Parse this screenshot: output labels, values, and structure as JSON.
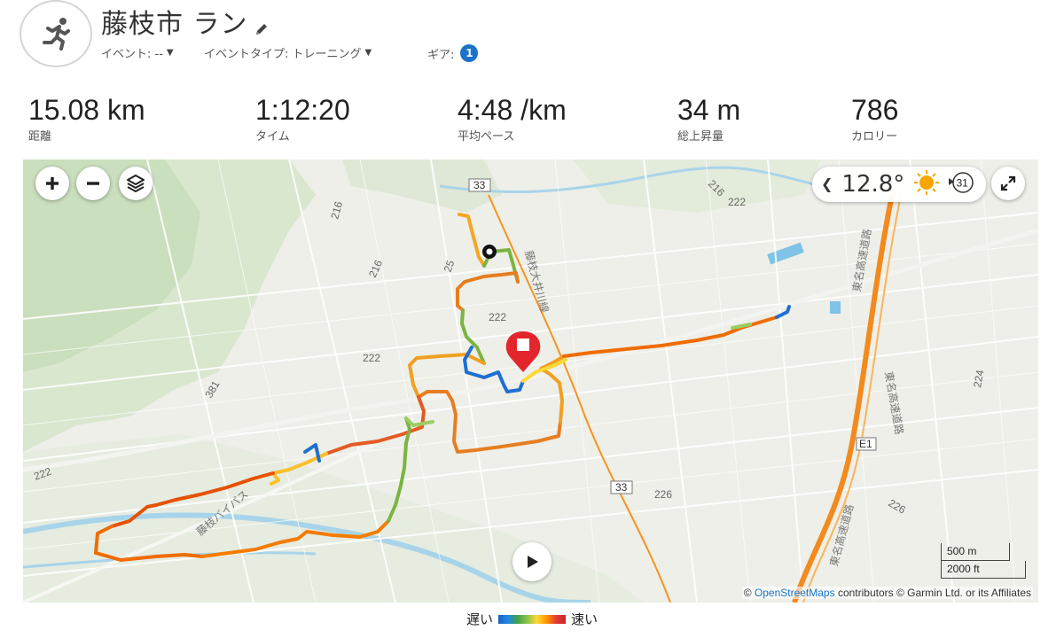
{
  "header": {
    "title": "藤枝市 ラン",
    "event": "イベント: --",
    "event_type": "イベントタイプ: トレーニング",
    "gear_label": "ギア:",
    "gear_count": "1"
  },
  "stats": [
    {
      "value": "15.08 km",
      "label": "距離"
    },
    {
      "value": "1:12:20",
      "label": "タイム"
    },
    {
      "value": "4:48 /km",
      "label": "平均ペース"
    },
    {
      "value": "34 m",
      "label": "総上昇量"
    },
    {
      "value": "786",
      "label": "カロリー"
    }
  ],
  "map": {
    "temperature": "12.8°",
    "wind_speed": "31",
    "scale_metric": "500 m",
    "scale_imperial": "2000 ft",
    "attribution_prefix": "©",
    "attribution_link": "OpenStreetMaps",
    "attribution_rest": "contributors © Garmin Ltd. or its Affiliates",
    "road_labels": [
      "33",
      "33",
      "E1",
      "216",
      "216",
      "216",
      "222",
      "222",
      "222",
      "222",
      "381",
      "224",
      "226",
      "226",
      "25"
    ],
    "highway_names": [
      "東名高速道路",
      "東名高速道路",
      "東名高速道路"
    ],
    "rail_label": "藤枝大井川線",
    "bypass_label": "藤枝バイパス"
  },
  "legend": {
    "slow": "遅い",
    "fast": "速い"
  },
  "colors": {
    "badge": "#1a73c8",
    "route_orange": "#ef6c00",
    "route_green": "#7cb342",
    "route_blue": "#1e6fd0",
    "highway": "#f7931e",
    "end_marker": "#e3262c"
  }
}
